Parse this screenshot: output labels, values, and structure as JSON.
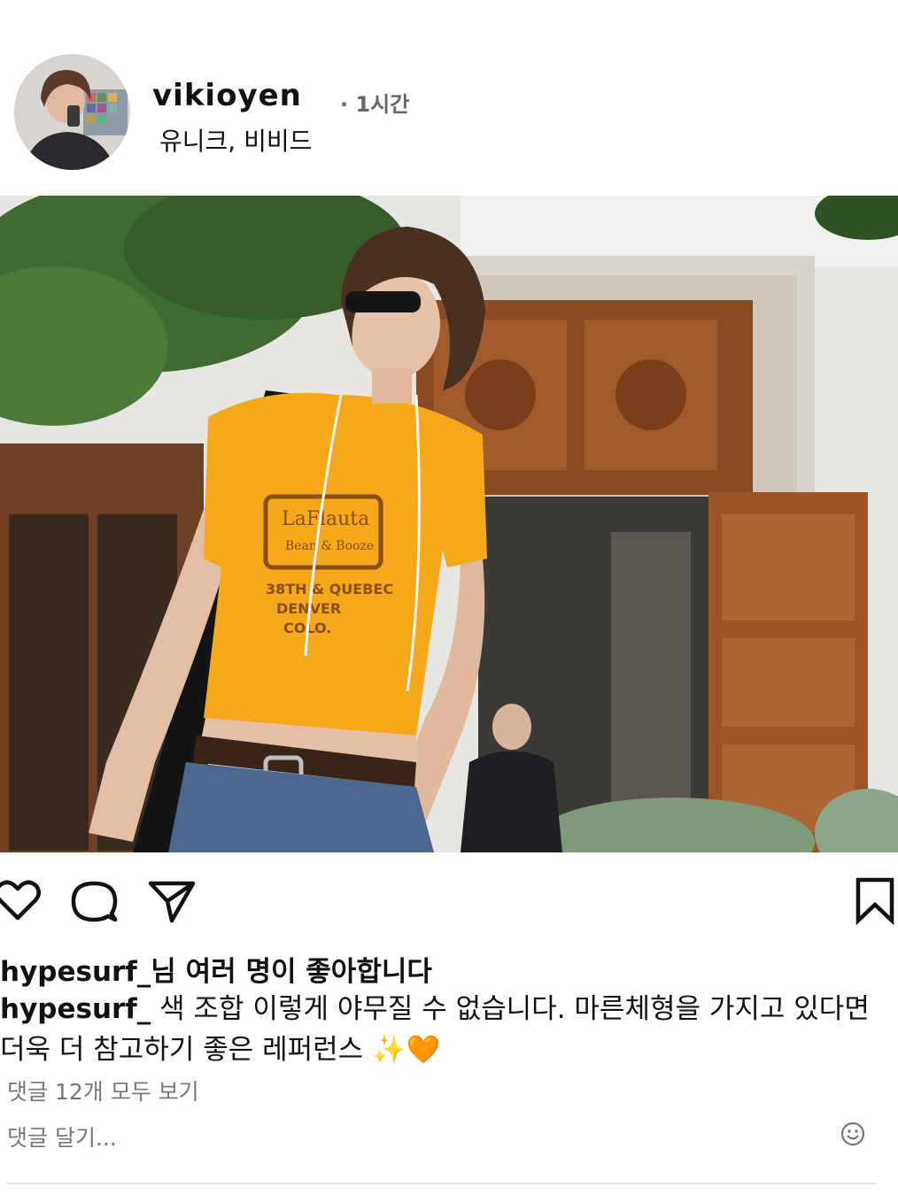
{
  "post": {
    "username": "vikioyen",
    "time_ago": "· 1시간",
    "location": "유니크, 비비드",
    "image": {
      "alt_icon": "photo-icon",
      "tshirt_text": [
        "LaFlauta",
        "Bean & Booze",
        "38TH & QUEBEC",
        "DENVER",
        "COLO."
      ]
    },
    "actions": {
      "like_icon": "heart-icon",
      "comment_icon": "comment-icon",
      "share_icon": "send-icon",
      "save_icon": "bookmark-icon"
    },
    "likes": {
      "user": "hypesurf_",
      "text": "님 여러 명이 좋아합니다"
    },
    "caption": {
      "user": "hypesurf_",
      "text": " 색 조합 이렇게 야무질 수 없습니다. 마른체형을 가지고 있다면 더욱 더 참고하기 좋은 레퍼런스 ✨🧡"
    },
    "view_comments": "댓글 12개 모두 보기",
    "add_comment_placeholder": "댓글 달기...",
    "emoji_icon": "smiley-icon"
  }
}
